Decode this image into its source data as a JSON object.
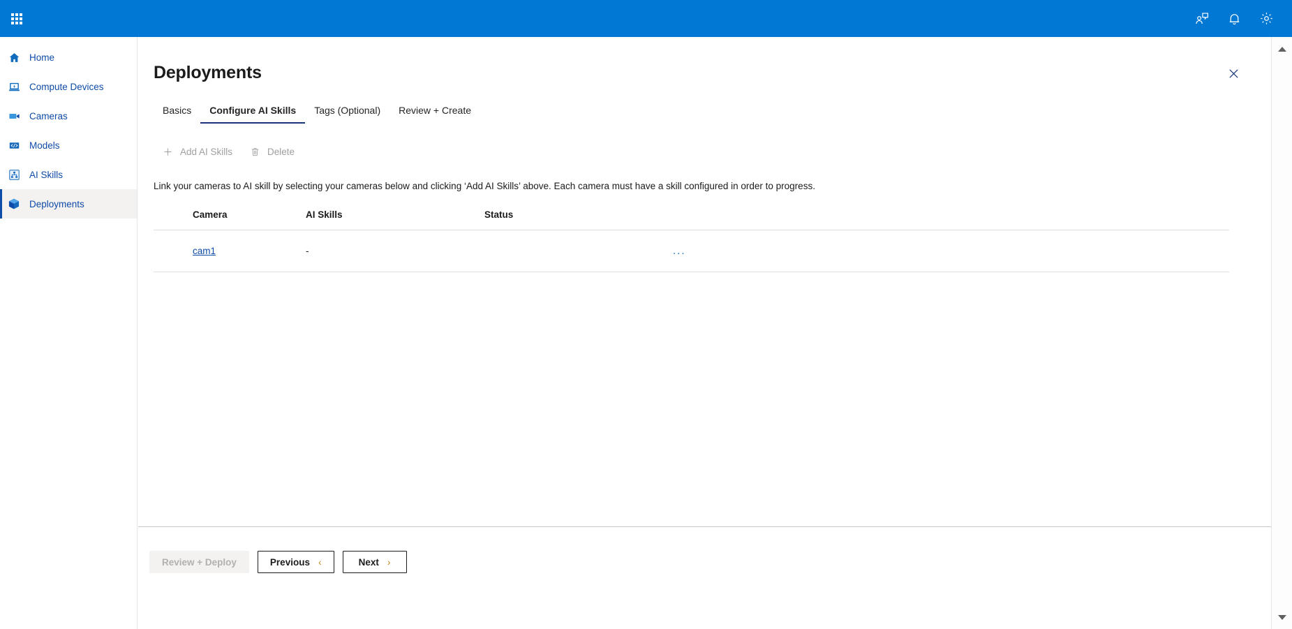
{
  "topbar": {
    "waffle_label": "app-launcher",
    "icons": [
      {
        "name": "feedback-icon",
        "label": "Feedback"
      },
      {
        "name": "notification-bell-icon",
        "label": "Notifications"
      },
      {
        "name": "settings-gear-icon",
        "label": "Settings"
      }
    ],
    "accent_color": "#0078d4"
  },
  "sidebar": {
    "items": [
      {
        "label": "Home",
        "icon": "home-icon",
        "selected": false
      },
      {
        "label": "Compute Devices",
        "icon": "compute-device-icon",
        "selected": false
      },
      {
        "label": "Cameras",
        "icon": "video-camera-icon",
        "selected": false
      },
      {
        "label": "Models",
        "icon": "code-model-icon",
        "selected": false
      },
      {
        "label": "AI Skills",
        "icon": "sitemap-skills-icon",
        "selected": false
      },
      {
        "label": "Deployments",
        "icon": "package-cube-icon",
        "selected": true
      }
    ],
    "link_color": "#0f4ba8"
  },
  "main": {
    "title": "Deployments",
    "close_icon": "close-icon",
    "tabs": [
      {
        "label": "Basics",
        "active": false
      },
      {
        "label": "Configure AI Skills",
        "active": true
      },
      {
        "label": "Tags (Optional)",
        "active": false
      },
      {
        "label": "Review + Create",
        "active": false
      }
    ],
    "commands": [
      {
        "label": "Add AI Skills",
        "icon": "plus-icon",
        "disabled": true
      },
      {
        "label": "Delete",
        "icon": "trash-icon",
        "disabled": true
      }
    ],
    "description": "Link your cameras to AI skill by selecting your cameras below and clicking ‘Add AI Skills’ above. Each camera must have a skill configured in order to progress.",
    "table": {
      "columns": [
        "Camera",
        "AI Skills",
        "Status"
      ],
      "rows": [
        {
          "camera": "cam1",
          "ai_skills": "-",
          "status": "",
          "menu": "..."
        }
      ]
    }
  },
  "footer": {
    "buttons": [
      {
        "label": "Review + Deploy",
        "chevron": "",
        "disabled": true
      },
      {
        "label": "Previous",
        "chevron": "‹",
        "disabled": false
      },
      {
        "label": "Next",
        "chevron": "›",
        "disabled": false
      }
    ]
  },
  "scrollbar": {
    "up_icon": "scroll-up-arrow-icon",
    "down_icon": "scroll-down-arrow-icon"
  }
}
